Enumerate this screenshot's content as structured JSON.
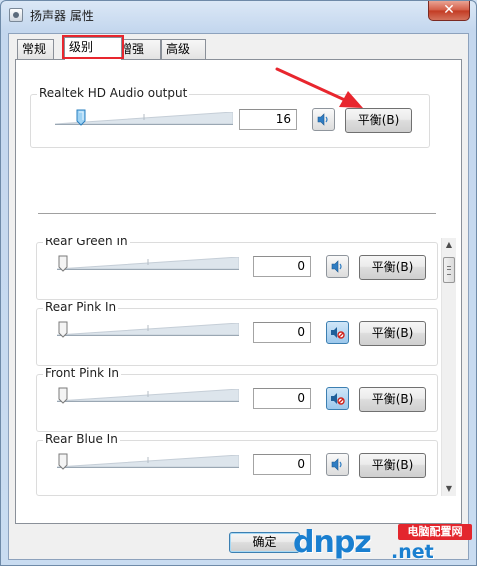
{
  "window": {
    "title": "扬声器 属性",
    "close_symbol": "✕",
    "icon": "speaker-properties-icon"
  },
  "tabs": [
    {
      "label": "常规",
      "active": false
    },
    {
      "label": "级别",
      "active": true
    },
    {
      "label": "增强",
      "active": false
    },
    {
      "label": "高级",
      "active": false
    }
  ],
  "highlight_color": "#e8262e",
  "main_channel": {
    "label": "Realtek HD Audio output",
    "value": "16",
    "level": 0.16,
    "muted": false,
    "balance_label": "平衡(B)"
  },
  "channels": [
    {
      "label": "Rear Green In",
      "value": "0",
      "level": 0,
      "muted": false,
      "balance_label": "平衡(B)"
    },
    {
      "label": "Rear Pink In",
      "value": "0",
      "level": 0,
      "muted": true,
      "balance_label": "平衡(B)"
    },
    {
      "label": "Front Pink In",
      "value": "0",
      "level": 0,
      "muted": true,
      "balance_label": "平衡(B)"
    },
    {
      "label": "Rear Blue In",
      "value": "0",
      "level": 0,
      "muted": false,
      "balance_label": "平衡(B)"
    }
  ],
  "footer": {
    "ok_label": "确定"
  },
  "watermark": {
    "logo": "dnpz",
    "tagline": "电脑配置网",
    "domain": ".net"
  }
}
